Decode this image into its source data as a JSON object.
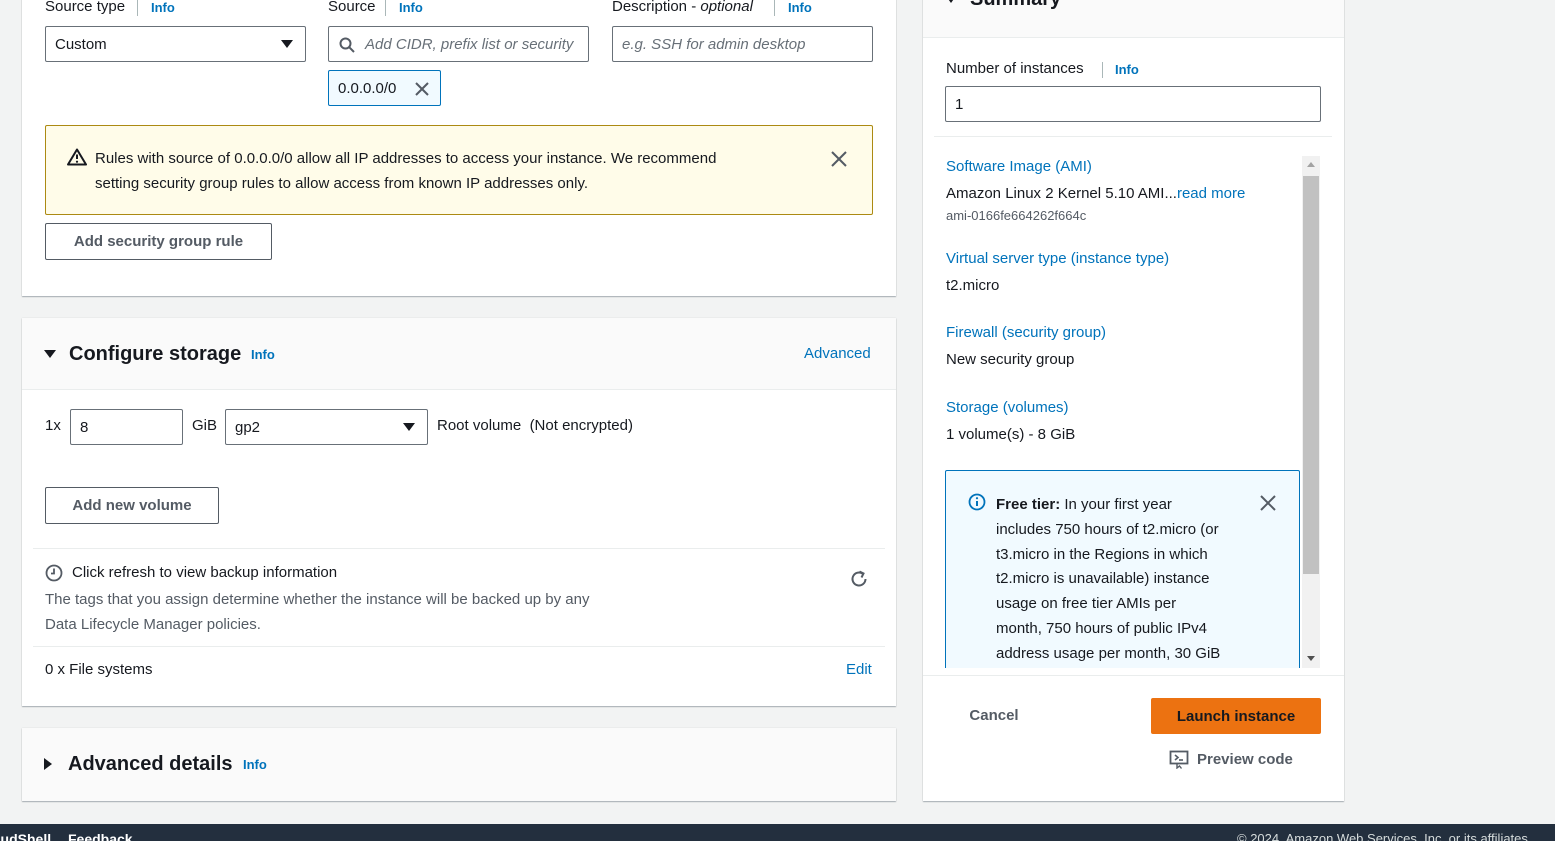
{
  "security_rule": {
    "source_type_label": "Source type",
    "source_type_info": "Info",
    "source_type_value": "Custom",
    "source_label": "Source",
    "source_info": "Info",
    "source_placeholder": "Add CIDR, prefix list or security",
    "source_token": "0.0.0.0/0",
    "description_label": "Description - ",
    "description_optional": "optional",
    "description_info": "Info",
    "description_placeholder": "e.g. SSH for admin desktop",
    "warning_line1": "Rules with source of 0.0.0.0/0 allow all IP addresses to access your instance. We recommend",
    "warning_line2": "setting security group rules to allow access from known IP addresses only.",
    "add_rule_button": "Add security group rule"
  },
  "storage": {
    "title": "Configure storage",
    "info": "Info",
    "advanced_link": "Advanced",
    "count_label": "1x",
    "size_value": "8",
    "unit": "GiB",
    "volume_type": "gp2",
    "volume_desc": "Root volume",
    "volume_encryption": "(Not encrypted)",
    "add_volume_button": "Add new volume",
    "backup_title": "Click refresh to view backup information",
    "backup_desc_line1": "The tags that you assign determine whether the instance will be backed up by any",
    "backup_desc_line2": "Data Lifecycle Manager policies.",
    "file_systems": "0 x File systems",
    "edit_link": "Edit"
  },
  "advanced_details": {
    "title": "Advanced details",
    "info": "Info"
  },
  "summary": {
    "title": "Summary",
    "instances_label": "Number of instances",
    "instances_info": "Info",
    "instances_value": "1",
    "ami_label": "Software Image (AMI)",
    "ami_value": "Amazon Linux 2 Kernel 5.10 AMI...",
    "ami_read_more": "read more",
    "ami_id": "ami-0166fe664262f664c",
    "instance_type_label": "Virtual server type (instance type)",
    "instance_type_value": "t2.micro",
    "firewall_label": "Firewall (security group)",
    "firewall_value": "New security group",
    "storage_label": "Storage (volumes)",
    "storage_value": "1 volume(s) - 8 GiB",
    "free_tier_bold": "Free tier:",
    "free_tier_line1": " In your first year",
    "free_tier_line2": "includes 750 hours of t2.micro (or",
    "free_tier_line3": "t3.micro in the Regions in which",
    "free_tier_line4": "t2.micro is unavailable) instance",
    "free_tier_line5": "usage on free tier AMIs per",
    "free_tier_line6": "month, 750 hours of public IPv4",
    "free_tier_line7": "address usage per month, 30 GiB",
    "cancel_button": "Cancel",
    "launch_button": "Launch instance",
    "preview_code": "Preview code"
  },
  "footer": {
    "cloudshell": "CloudShell",
    "feedback": "Feedback",
    "copyright": "© 2024, Amazon Web Services, Inc. or its affiliates."
  },
  "colors": {
    "link": "#0073bb",
    "primary_button": "#ec7211",
    "warning_bg": "#fffce9",
    "warning_border": "#ac8a12",
    "info_border": "#0073bb",
    "footer_bg": "#232f3e"
  }
}
